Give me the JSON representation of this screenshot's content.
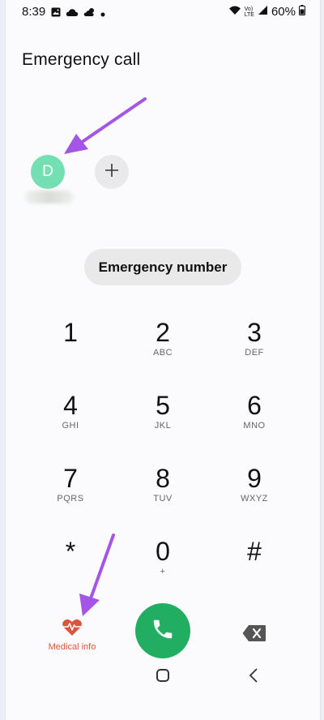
{
  "status_bar": {
    "time": "8:39",
    "battery_percent": "60%",
    "network_label": "VoLTE",
    "icons": [
      "gallery-icon",
      "cloud-icon",
      "cloud-sun-icon",
      "dot-icon",
      "wifi-icon",
      "signal-icon",
      "battery-icon"
    ]
  },
  "page": {
    "title": "Emergency call"
  },
  "contacts": [
    {
      "initial": "D",
      "color": "#74dfb2"
    }
  ],
  "emergency_number_label": "Emergency number",
  "keypad": [
    {
      "digit": "1",
      "letters": ""
    },
    {
      "digit": "2",
      "letters": "ABC"
    },
    {
      "digit": "3",
      "letters": "DEF"
    },
    {
      "digit": "4",
      "letters": "GHI"
    },
    {
      "digit": "5",
      "letters": "JKL"
    },
    {
      "digit": "6",
      "letters": "MNO"
    },
    {
      "digit": "7",
      "letters": "PQRS"
    },
    {
      "digit": "8",
      "letters": "TUV"
    },
    {
      "digit": "9",
      "letters": "WXYZ"
    },
    {
      "digit": "*",
      "letters": ""
    },
    {
      "digit": "0",
      "letters": "+"
    },
    {
      "digit": "#",
      "letters": ""
    }
  ],
  "bottom": {
    "medical_info_label": "Medical info"
  },
  "colors": {
    "call_green": "#22ae62",
    "medical_red": "#d9553e",
    "annotation_purple": "#a455e8",
    "avatar_green": "#74dfb2"
  }
}
